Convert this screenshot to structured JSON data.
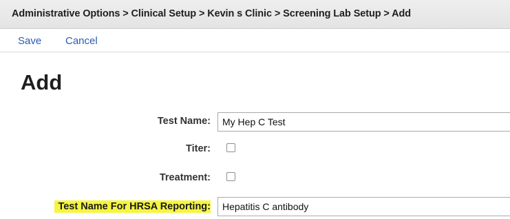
{
  "breadcrumb": {
    "text": "Administrative Options > Clinical Setup > Kevin s Clinic > Screening Lab Setup > Add"
  },
  "toolbar": {
    "save_label": "Save",
    "cancel_label": "Cancel"
  },
  "page": {
    "title": "Add"
  },
  "form": {
    "test_name": {
      "label": "Test Name:",
      "value": "My Hep C Test"
    },
    "titer": {
      "label": "Titer:",
      "checked": false
    },
    "treatment": {
      "label": "Treatment:",
      "checked": false
    },
    "hrsa_test_name": {
      "label": "Test Name For HRSA Reporting:",
      "value": "Hepatitis C antibody",
      "highlight_color": "#f5f542"
    }
  },
  "colors": {
    "link": "#2a5bb5",
    "header_bg": "#e9e9e9"
  }
}
